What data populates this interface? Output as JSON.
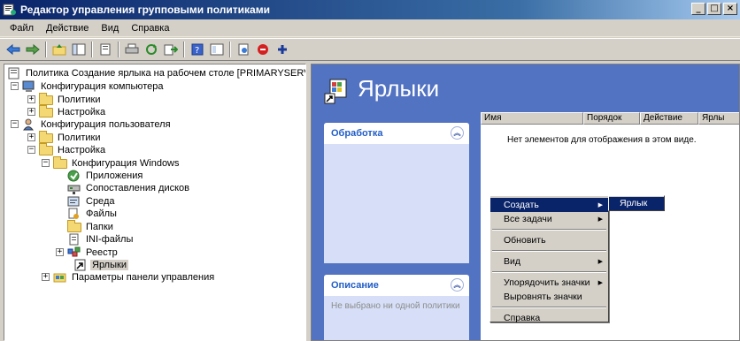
{
  "window": {
    "title": "Редактор управления групповыми политиками",
    "buttons": [
      "_",
      "□",
      "×"
    ]
  },
  "menu": [
    "Файл",
    "Действие",
    "Вид",
    "Справка"
  ],
  "toolbar": [
    "back-arrow-icon",
    "forward-arrow-icon",
    "up-folder-icon",
    "show-hide-tree-icon",
    "properties-icon",
    "print-icon",
    "refresh-icon",
    "export-icon",
    "help-icon",
    "help-topics-icon",
    "new-icon",
    "stop-icon",
    "add-icon"
  ],
  "tree": {
    "root": "Политика Создание ярлыка на рабочем столе [PRIMARYSERVER.OFFIC",
    "computer_config": "Конфигурация компьютера",
    "computer_policies": "Политики",
    "computer_prefs": "Настройка",
    "user_config": "Конфигурация пользователя",
    "user_policies": "Политики",
    "user_prefs": "Настройка",
    "windows_config": "Конфигурация Windows",
    "applications": "Приложения",
    "drive_maps": "Сопоставления дисков",
    "environment": "Среда",
    "files": "Файлы",
    "folders": "Папки",
    "ini_files": "INI-файлы",
    "registry": "Реестр",
    "shortcuts": "Ярлыки",
    "control_panel": "Параметры панели управления"
  },
  "right": {
    "title": "Ярлыки",
    "processing_label": "Обработка",
    "description_label": "Описание",
    "description_text": "Не выбрано ни одной политики",
    "columns": [
      "Имя",
      "Порядок",
      "Действие",
      "Ярлы"
    ],
    "empty_message": "Нет элементов для отображения в этом виде."
  },
  "context_menu": {
    "create": "Создать",
    "all_tasks": "Все задачи",
    "refresh": "Обновить",
    "view": "Вид",
    "arrange_icons": "Упорядочить значки",
    "line_up_icons": "Выровнять значки",
    "help": "Справка",
    "submenu_shortcut": "Ярлык"
  },
  "colors": {
    "titlebar": "#0a246a",
    "right_pane_bg": "#5272c2",
    "task_panel": "#d6dff7",
    "highlight": "#0a246a"
  }
}
